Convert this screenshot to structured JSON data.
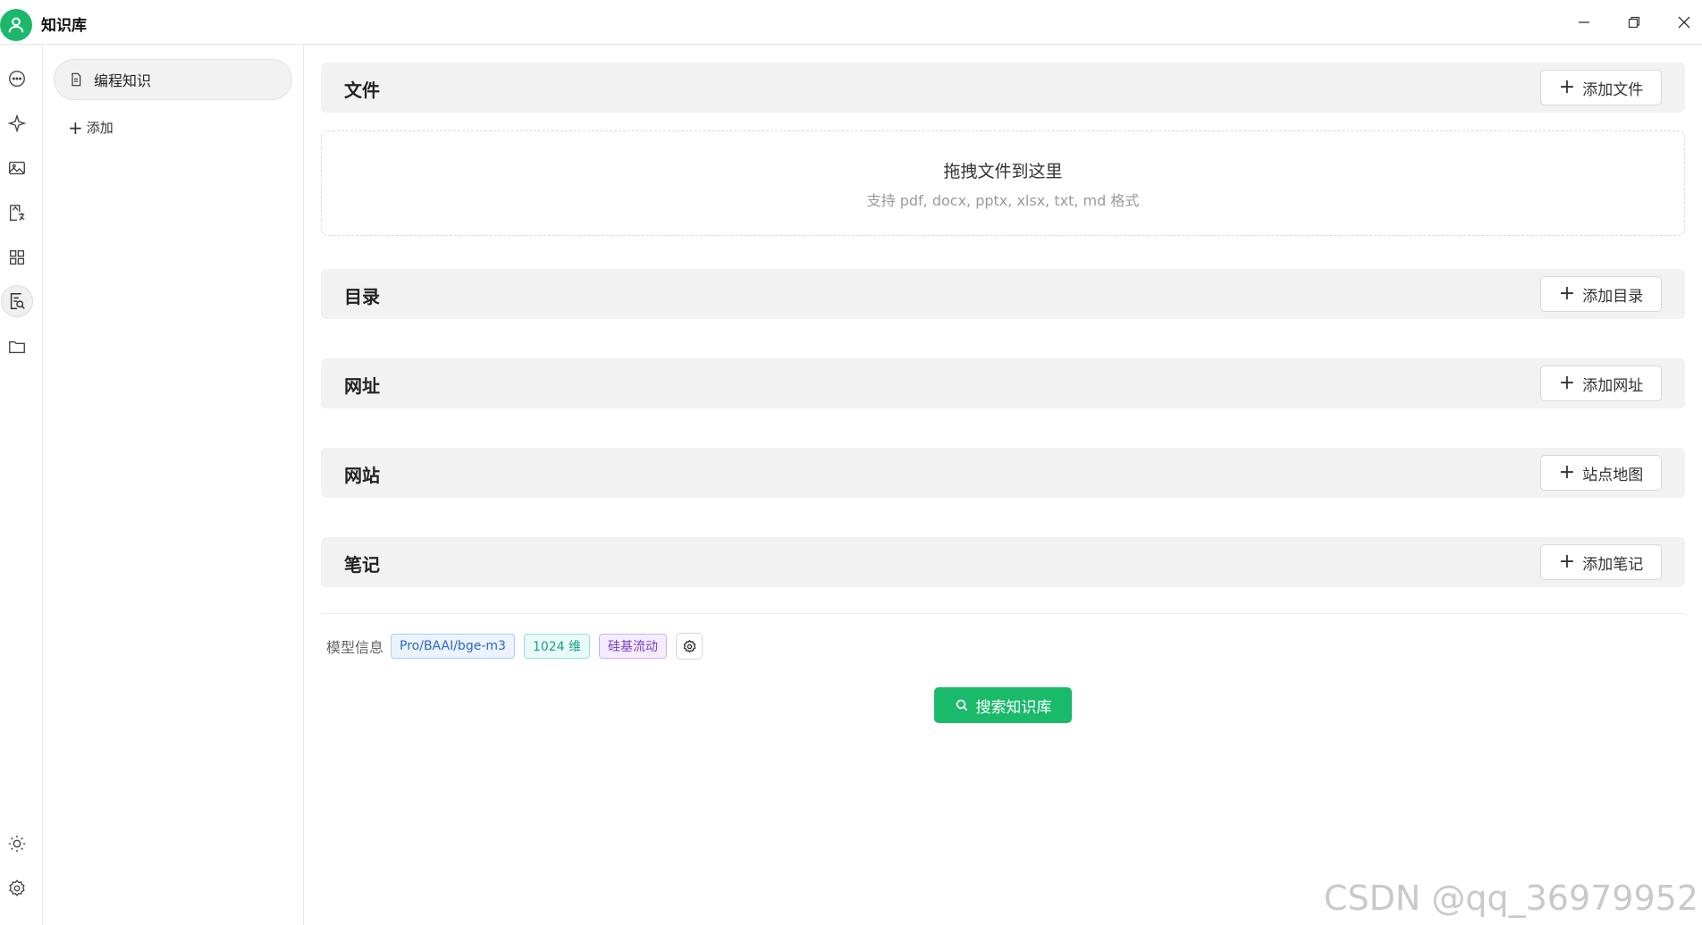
{
  "window": {
    "title": "知识库"
  },
  "rail": {
    "top_icons": [
      "chat-icon",
      "sparkle-icon",
      "image-icon",
      "translate-icon",
      "apps-icon",
      "knowledge-icon",
      "folder-icon"
    ],
    "bottom_icons": [
      "theme-icon",
      "settings-icon"
    ],
    "active": "knowledge-icon"
  },
  "kb_list": {
    "items": [
      {
        "label": "编程知识"
      }
    ],
    "add_label": "添加"
  },
  "sections": {
    "file": {
      "title": "文件",
      "button": "添加文件"
    },
    "directory": {
      "title": "目录",
      "button": "添加目录"
    },
    "url": {
      "title": "网址",
      "button": "添加网址"
    },
    "website": {
      "title": "网站",
      "button": "站点地图"
    },
    "note": {
      "title": "笔记",
      "button": "添加笔记"
    }
  },
  "dropzone": {
    "title": "拖拽文件到这里",
    "subtitle": "支持 pdf, docx, pptx, xlsx, txt, md 格式"
  },
  "model_info": {
    "label": "模型信息",
    "tags": [
      "Pro/BAAI/bge-m3",
      "1024 维",
      "硅基流动"
    ]
  },
  "search_button": "搜索知识库",
  "watermark": "CSDN @qq_36979952",
  "colors": {
    "accent": "#1aba6b",
    "section_bg": "#f2f2f2"
  }
}
